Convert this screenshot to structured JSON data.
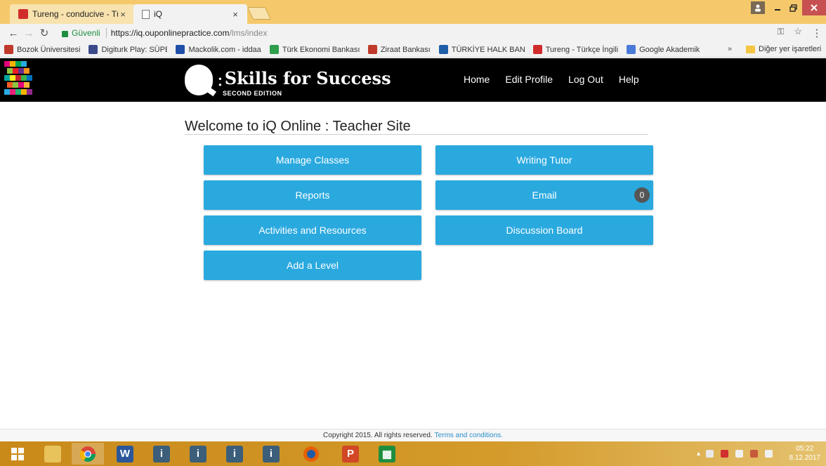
{
  "browser": {
    "tabs": [
      {
        "title": "Tureng - conducive - Tür",
        "close": "×"
      },
      {
        "title": "iQ",
        "close": "×"
      }
    ],
    "secure_label": "Güvenli",
    "url_host": "https://iq.ouponlinepractice.com",
    "url_path": "/lms/index",
    "bookmarks": [
      {
        "label": "Bozok Üniversitesi",
        "color": "#c0392b"
      },
      {
        "label": "Digiturk Play: SÜPER",
        "color": "#3a4a8a"
      },
      {
        "label": "Mackolik.com - iddaa",
        "color": "#1f4fa8"
      },
      {
        "label": "Türk Ekonomi Bankası",
        "color": "#2e9e4a"
      },
      {
        "label": "Ziraat Bankası",
        "color": "#c0392b"
      },
      {
        "label": "TÜRKİYE HALK BANK",
        "color": "#1f5fa8"
      },
      {
        "label": "Tureng - Türkçe İngili",
        "color": "#d12c2c"
      },
      {
        "label": "Google Akademik",
        "color": "#4a7bd9"
      }
    ],
    "bookmarks_more": "»",
    "other_bookmarks": "Diğer yer işaretleri"
  },
  "site": {
    "logo_colon": ":",
    "logo_text": "Skills for Success",
    "logo_edition": "SECOND EDITION",
    "nav": {
      "home": "Home",
      "edit_profile": "Edit Profile",
      "log_out": "Log Out",
      "help": "Help"
    }
  },
  "main": {
    "title": "Welcome to iQ Online : Teacher Site",
    "buttons": {
      "manage_classes": "Manage Classes",
      "writing_tutor": "Writing Tutor",
      "reports": "Reports",
      "email": "Email",
      "activities": "Activities and Resources",
      "discussion_board": "Discussion Board",
      "add_level": "Add a Level"
    },
    "email_count": "0"
  },
  "footer": {
    "copyright": "Copyright 2015. All rights reserved.",
    "terms": "Terms and conditions."
  },
  "taskbar": {
    "clock_time": "05:22",
    "clock_date": "8.12.2017"
  },
  "colors": {
    "accent": "#2aa9df",
    "header_bg": "#000000",
    "tabstrip": "#f5c96b"
  }
}
